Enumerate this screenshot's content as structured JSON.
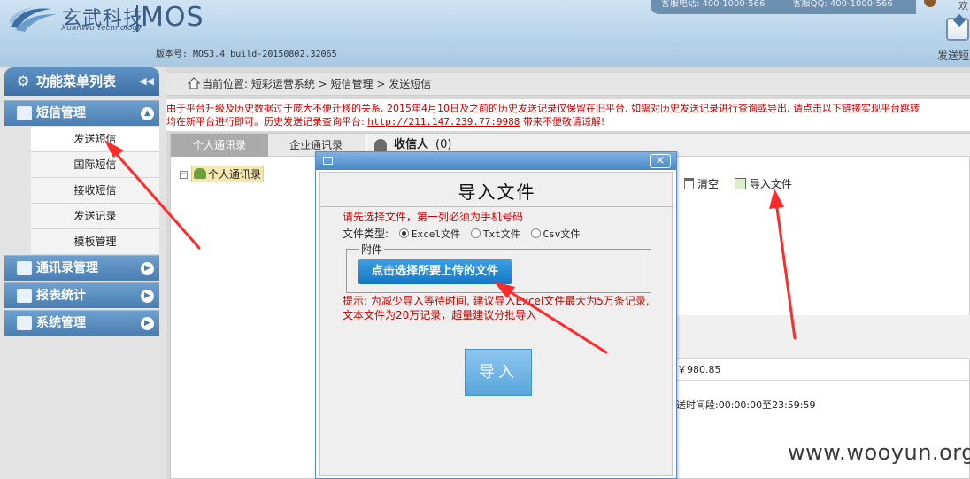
{
  "header": {
    "brand_cn": "玄武科技",
    "brand_en": "XuanWu Technology",
    "product": "MOS",
    "version": "版本号: MOS3.4 build-20150802.32065",
    "service_phone": "客服电话: 400-1000-566",
    "service_qq": "客服QQ: 400-1000-566",
    "user_greeting": "欢",
    "shortcut_send": "发送短"
  },
  "sidebar": {
    "title": "功能菜单列表",
    "groups": [
      {
        "label": "短信管理",
        "items": [
          "发送短信",
          "国际短信",
          "接收短信",
          "发送记录",
          "模板管理"
        ]
      },
      {
        "label": "通讯录管理"
      },
      {
        "label": "报表统计"
      },
      {
        "label": "系统管理"
      }
    ],
    "active_item": "发送短信"
  },
  "breadcrumb": "当前位置: 短彩运营系统 > 短信管理 > 发送短信",
  "notice": {
    "line1": "由于平台升级及历史数据过于庞大不便迁移的关系, 2015年4月10日及之前的历史发送记录仅保留在旧平台, 如需对历史发送记录进行查询或导出, 请点击以下链接实现平台跳转",
    "line2_prefix": "均在新平台进行即可。历史发送记录查询平台: ",
    "link": "http://211.147.239.77:9988",
    "line2_suffix": " 带来不便敬请谅解!"
  },
  "main": {
    "tabs": [
      "个人通讯录",
      "企业通讯录"
    ],
    "tree_node": "个人通讯录",
    "recipients_label": "收信人",
    "recipients_count": "(0)",
    "clear_label": "清空",
    "import_label": "导入文件",
    "balance": "￥980.85",
    "send_time": "送时间段:00:00:00至23:59:59"
  },
  "modal": {
    "title": "导入文件",
    "hint": "请先选择文件，第一列必须为手机号码",
    "file_type_label": "文件类型:",
    "options": [
      "Excel文件",
      "Txt文件",
      "Csv文件"
    ],
    "selected_option": "Excel文件",
    "attachment_legend": "附件",
    "upload_button": "点击选择所要上传的文件",
    "tip_line1": "提示: 为减少导入等待时间, 建议导入Excel文件最大为5万条记录,",
    "tip_line2": "文本文件为20万记录，超量建议分批导入",
    "import_button": "导入"
  },
  "watermark": "www.wooyun.org",
  "colors": {
    "accent_blue": "#4a7eb1",
    "warning_red": "#c40000",
    "annotation_arrow": "#ff2a2a"
  }
}
